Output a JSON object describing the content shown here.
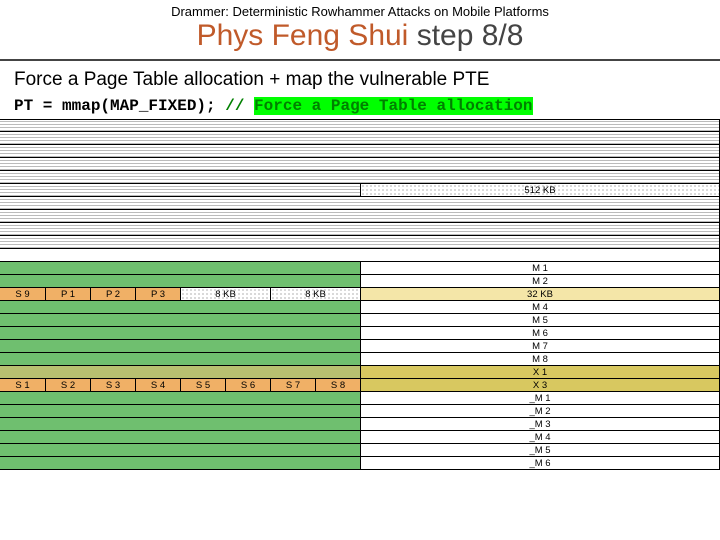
{
  "header": "Drammer: Deterministic Rowhammer Attacks on Mobile Platforms",
  "title": {
    "prefix": "Phys Feng Shui",
    "suffix": " step 8/8"
  },
  "subtitle": "Force a Page Table allocation + map the vulnerable PTE",
  "code": {
    "lhs": "PT = mmap(MAP_FIXED);",
    "comment_slashes": " // ",
    "comment_text": "Force a Page Table allocation"
  },
  "labels": {
    "kb512": "512 KB",
    "M1": "M 1",
    "M2": "M 2",
    "S9": "S 9",
    "P1": "P 1",
    "P2": "P 2",
    "P3": "P 3",
    "kb8a": "8 KB",
    "kb8b": "8 KB",
    "kb32": "32 KB",
    "M4": "M 4",
    "M5": "M 5",
    "M6": "M 6",
    "M7": "M 7",
    "M8": "M 8",
    "X1": "X 1",
    "S1": "S 1",
    "S2": "S 2",
    "S3": "S 3",
    "S4": "S 4",
    "S5": "S 5",
    "S6": "S 6",
    "S7": "S 7",
    "S8": "S 8",
    "X3": "X 3",
    "_M1": "_M 1",
    "_M2": "_M 2",
    "_M3": "_M 3",
    "_M4": "_M 4",
    "_M5": "_M 5",
    "_M6": "_M 6"
  }
}
